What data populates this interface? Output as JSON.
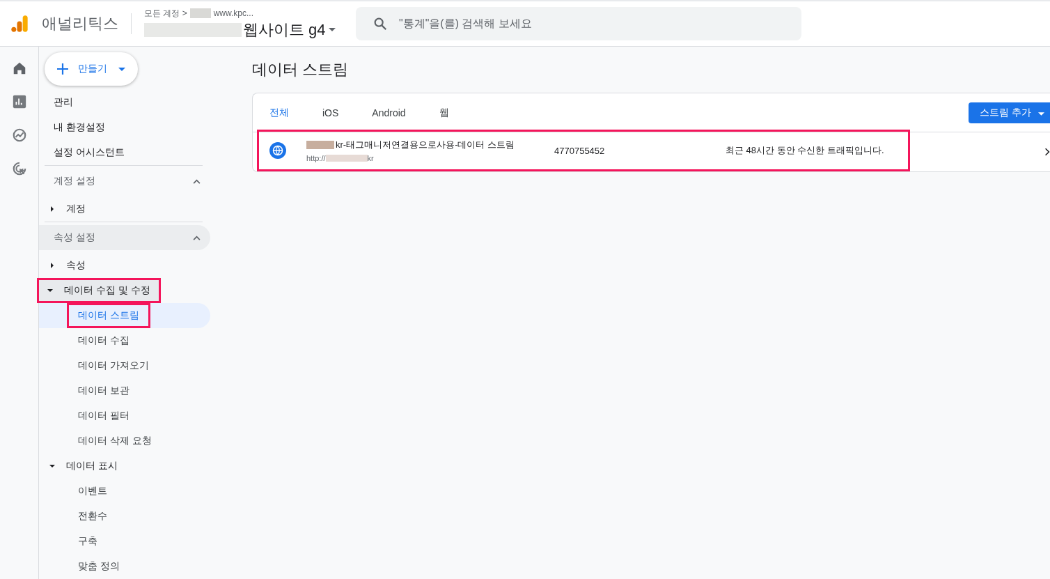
{
  "header": {
    "product": "애널리틱스",
    "breadcrumb": "모든 계정 >",
    "account_hint": "www.kpc...",
    "property": "웹사이트 g4",
    "search": {
      "placeholder": "\"통계\"을(를) 검색해 보세요"
    }
  },
  "rail": [
    {
      "kind": "home",
      "selected": true
    },
    {
      "kind": "reports",
      "selected": false
    },
    {
      "kind": "explore",
      "selected": false
    },
    {
      "kind": "advertising",
      "selected": false
    }
  ],
  "create_button": {
    "label": "만들기"
  },
  "nav": {
    "top_items": [
      {
        "label": "관리"
      },
      {
        "label": "내 환경설정"
      },
      {
        "label": "설정 어시스턴트"
      }
    ],
    "sections": [
      {
        "label": "계정 설정",
        "expanded": true,
        "shaded": false,
        "children": [
          {
            "label": "계정",
            "expanded": false,
            "highlighted": false,
            "shaded": false
          }
        ]
      },
      {
        "label": "속성 설정",
        "expanded": true,
        "shaded": true,
        "children": [
          {
            "label": "속성",
            "expanded": false,
            "highlighted": false,
            "shaded": false
          },
          {
            "label": "데이터 수집 및 수정",
            "expanded": true,
            "highlighted": true,
            "shaded": true,
            "children": [
              {
                "label": "데이터 스트림",
                "selected": true,
                "highlighted": true
              },
              {
                "label": "데이터 수집",
                "selected": false,
                "highlighted": false
              },
              {
                "label": "데이터 가져오기",
                "selected": false,
                "highlighted": false
              },
              {
                "label": "데이터 보관",
                "selected": false,
                "highlighted": false
              },
              {
                "label": "데이터 필터",
                "selected": false,
                "highlighted": false
              },
              {
                "label": "데이터 삭제 요청",
                "selected": false,
                "highlighted": false
              }
            ]
          },
          {
            "label": "데이터 표시",
            "expanded": true,
            "highlighted": false,
            "shaded": false,
            "children": [
              {
                "label": "이벤트",
                "selected": false,
                "highlighted": false
              },
              {
                "label": "전환수",
                "selected": false,
                "highlighted": false
              },
              {
                "label": "구축",
                "selected": false,
                "highlighted": false
              },
              {
                "label": "맞춤 정의",
                "selected": false,
                "highlighted": false
              }
            ]
          }
        ]
      }
    ]
  },
  "page_title": "데이터 스트림",
  "tabs": [
    {
      "label": "전체",
      "selected": true
    },
    {
      "label": "iOS",
      "selected": false
    },
    {
      "label": "Android",
      "selected": false
    },
    {
      "label": "웹",
      "selected": false
    }
  ],
  "add_stream_button": {
    "label": "스트림 추가"
  },
  "streams": [
    {
      "name": "kr-태그매니저연결용으로사용-데이터 스트림",
      "url_prefix": "http://",
      "url_suffix": "kr",
      "id": "4770755452",
      "status": "최근 48시간 동안 수신한 트래픽입니다.",
      "highlighted": true
    }
  ]
}
